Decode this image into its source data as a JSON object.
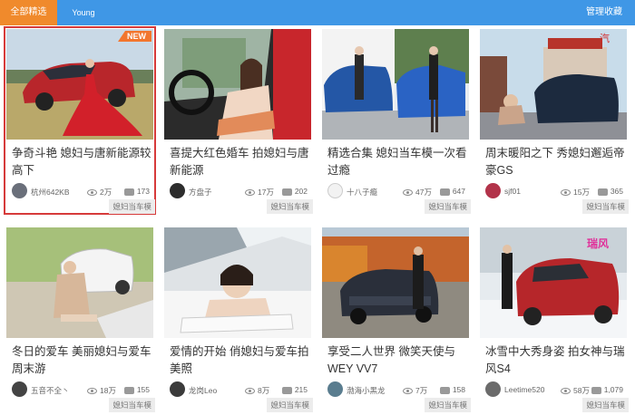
{
  "topbar": {
    "active_tab": "全部精选",
    "tab2": "Young",
    "manage": "管理收藏"
  },
  "cards": [
    {
      "title": "争奇斗艳 媳妇与唐新能源较高下",
      "author": "杭州642KB",
      "views": "2万",
      "comments": "173",
      "source": "媳妇当车模",
      "badge": "NEW"
    },
    {
      "title": "喜提大红色婚车 拍媳妇与唐新能源",
      "author": "方盘子",
      "views": "17万",
      "comments": "202",
      "source": "媳妇当车模"
    },
    {
      "title": "精选合集 媳妇当车模一次看过瘾",
      "author": "十八子瘾",
      "views": "47万",
      "comments": "647",
      "source": "媳妇当车模"
    },
    {
      "title": "周末暖阳之下 秀媳妇邂逅帝豪GS",
      "author": "sjf01",
      "views": "15万",
      "comments": "365",
      "source": "媳妇当车模"
    },
    {
      "title": "冬日的爱车 美丽媳妇与爱车周末游",
      "author": "五音不全丶",
      "views": "18万",
      "comments": "155",
      "source": "媳妇当车模"
    },
    {
      "title": "爱情的开始 俏媳妇与爱车拍美照",
      "author": "龙岗Leo",
      "views": "8万",
      "comments": "215",
      "source": "媳妇当车模"
    },
    {
      "title": "享受二人世界 微笑天使与WEY VV7",
      "author": "渤海小黑龙",
      "views": "7万",
      "comments": "158",
      "source": "媳妇当车模"
    },
    {
      "title": "冰雪中大秀身姿 拍女神与瑞风S4",
      "author": "Leetime520",
      "views": "58万",
      "comments": "1,079",
      "source": "媳妇当车模"
    }
  ],
  "colors": {
    "topbar": "#3f97e6",
    "active_tab": "#f08a2c",
    "selected_border": "#d63a3a",
    "new_badge": "#f2762e"
  }
}
